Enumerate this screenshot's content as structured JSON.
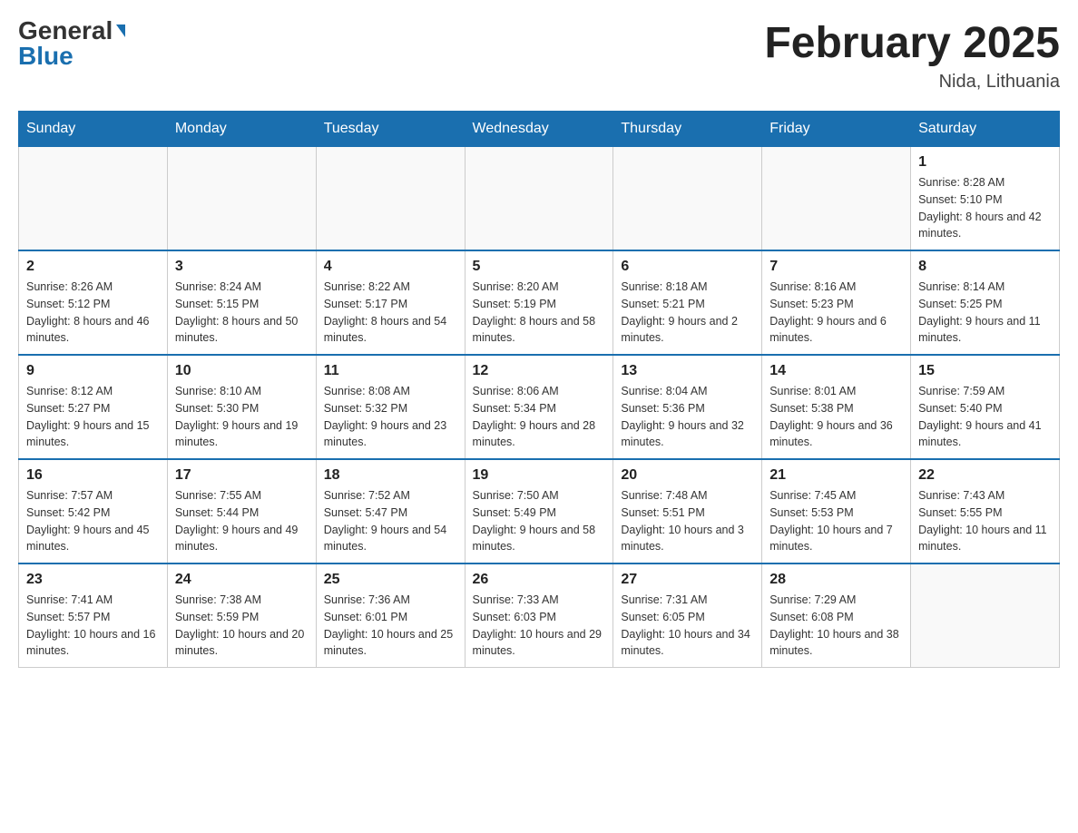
{
  "header": {
    "logo_general": "General",
    "logo_blue": "Blue",
    "title": "February 2025",
    "location": "Nida, Lithuania"
  },
  "days_of_week": [
    "Sunday",
    "Monday",
    "Tuesday",
    "Wednesday",
    "Thursday",
    "Friday",
    "Saturday"
  ],
  "weeks": [
    {
      "days": [
        {
          "num": "",
          "info": ""
        },
        {
          "num": "",
          "info": ""
        },
        {
          "num": "",
          "info": ""
        },
        {
          "num": "",
          "info": ""
        },
        {
          "num": "",
          "info": ""
        },
        {
          "num": "",
          "info": ""
        },
        {
          "num": "1",
          "info": "Sunrise: 8:28 AM\nSunset: 5:10 PM\nDaylight: 8 hours and 42 minutes."
        }
      ]
    },
    {
      "days": [
        {
          "num": "2",
          "info": "Sunrise: 8:26 AM\nSunset: 5:12 PM\nDaylight: 8 hours and 46 minutes."
        },
        {
          "num": "3",
          "info": "Sunrise: 8:24 AM\nSunset: 5:15 PM\nDaylight: 8 hours and 50 minutes."
        },
        {
          "num": "4",
          "info": "Sunrise: 8:22 AM\nSunset: 5:17 PM\nDaylight: 8 hours and 54 minutes."
        },
        {
          "num": "5",
          "info": "Sunrise: 8:20 AM\nSunset: 5:19 PM\nDaylight: 8 hours and 58 minutes."
        },
        {
          "num": "6",
          "info": "Sunrise: 8:18 AM\nSunset: 5:21 PM\nDaylight: 9 hours and 2 minutes."
        },
        {
          "num": "7",
          "info": "Sunrise: 8:16 AM\nSunset: 5:23 PM\nDaylight: 9 hours and 6 minutes."
        },
        {
          "num": "8",
          "info": "Sunrise: 8:14 AM\nSunset: 5:25 PM\nDaylight: 9 hours and 11 minutes."
        }
      ]
    },
    {
      "days": [
        {
          "num": "9",
          "info": "Sunrise: 8:12 AM\nSunset: 5:27 PM\nDaylight: 9 hours and 15 minutes."
        },
        {
          "num": "10",
          "info": "Sunrise: 8:10 AM\nSunset: 5:30 PM\nDaylight: 9 hours and 19 minutes."
        },
        {
          "num": "11",
          "info": "Sunrise: 8:08 AM\nSunset: 5:32 PM\nDaylight: 9 hours and 23 minutes."
        },
        {
          "num": "12",
          "info": "Sunrise: 8:06 AM\nSunset: 5:34 PM\nDaylight: 9 hours and 28 minutes."
        },
        {
          "num": "13",
          "info": "Sunrise: 8:04 AM\nSunset: 5:36 PM\nDaylight: 9 hours and 32 minutes."
        },
        {
          "num": "14",
          "info": "Sunrise: 8:01 AM\nSunset: 5:38 PM\nDaylight: 9 hours and 36 minutes."
        },
        {
          "num": "15",
          "info": "Sunrise: 7:59 AM\nSunset: 5:40 PM\nDaylight: 9 hours and 41 minutes."
        }
      ]
    },
    {
      "days": [
        {
          "num": "16",
          "info": "Sunrise: 7:57 AM\nSunset: 5:42 PM\nDaylight: 9 hours and 45 minutes."
        },
        {
          "num": "17",
          "info": "Sunrise: 7:55 AM\nSunset: 5:44 PM\nDaylight: 9 hours and 49 minutes."
        },
        {
          "num": "18",
          "info": "Sunrise: 7:52 AM\nSunset: 5:47 PM\nDaylight: 9 hours and 54 minutes."
        },
        {
          "num": "19",
          "info": "Sunrise: 7:50 AM\nSunset: 5:49 PM\nDaylight: 9 hours and 58 minutes."
        },
        {
          "num": "20",
          "info": "Sunrise: 7:48 AM\nSunset: 5:51 PM\nDaylight: 10 hours and 3 minutes."
        },
        {
          "num": "21",
          "info": "Sunrise: 7:45 AM\nSunset: 5:53 PM\nDaylight: 10 hours and 7 minutes."
        },
        {
          "num": "22",
          "info": "Sunrise: 7:43 AM\nSunset: 5:55 PM\nDaylight: 10 hours and 11 minutes."
        }
      ]
    },
    {
      "days": [
        {
          "num": "23",
          "info": "Sunrise: 7:41 AM\nSunset: 5:57 PM\nDaylight: 10 hours and 16 minutes."
        },
        {
          "num": "24",
          "info": "Sunrise: 7:38 AM\nSunset: 5:59 PM\nDaylight: 10 hours and 20 minutes."
        },
        {
          "num": "25",
          "info": "Sunrise: 7:36 AM\nSunset: 6:01 PM\nDaylight: 10 hours and 25 minutes."
        },
        {
          "num": "26",
          "info": "Sunrise: 7:33 AM\nSunset: 6:03 PM\nDaylight: 10 hours and 29 minutes."
        },
        {
          "num": "27",
          "info": "Sunrise: 7:31 AM\nSunset: 6:05 PM\nDaylight: 10 hours and 34 minutes."
        },
        {
          "num": "28",
          "info": "Sunrise: 7:29 AM\nSunset: 6:08 PM\nDaylight: 10 hours and 38 minutes."
        },
        {
          "num": "",
          "info": ""
        }
      ]
    }
  ]
}
